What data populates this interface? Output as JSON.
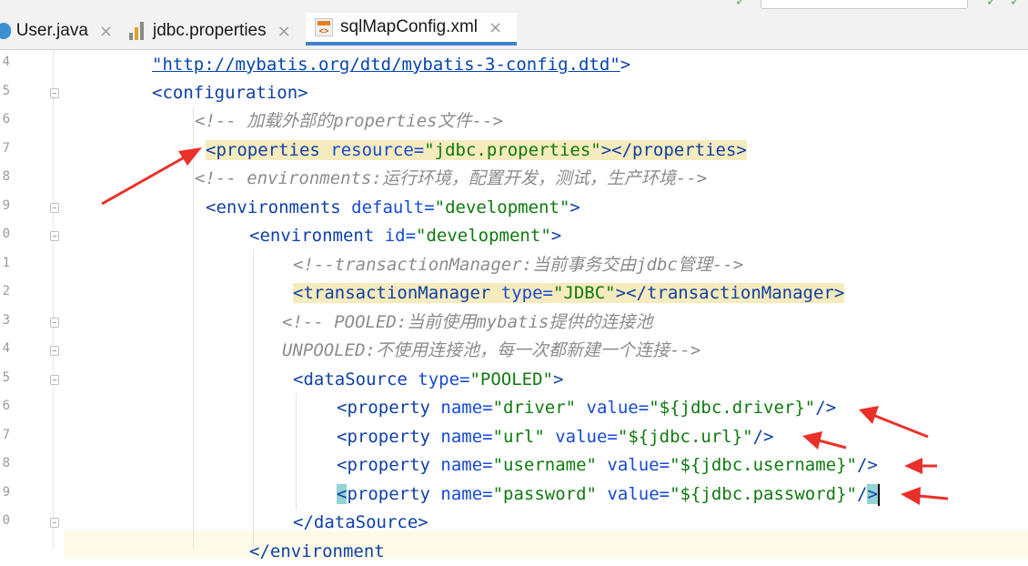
{
  "tabs": [
    {
      "label": "User.java",
      "icon": "java-class-icon"
    },
    {
      "label": "jdbc.properties",
      "icon": "properties-file-icon"
    },
    {
      "label": "sqlMapConfig.xml",
      "icon": "xml-file-icon",
      "active": true
    }
  ],
  "gutter": {
    "line_numbers": [
      "4",
      "5",
      "6",
      "7",
      "8",
      "9",
      "0",
      "1",
      "2",
      "3",
      "4",
      "5",
      "6",
      "7",
      "8",
      "9",
      "0"
    ]
  },
  "code": {
    "l1_url": "\"http://mybatis.org/dtd/mybatis-3-config.dtd\"",
    "l1_end": ">",
    "l2_tag": "<configuration>",
    "l3_comment": "<!-- 加载外部的properties文件-->",
    "l4_open": "<properties",
    "l4_attr": " resource=",
    "l4_val": "\"jdbc.properties\"",
    "l4_close": "></properties>",
    "l5_comment": "<!-- environments:运行环境，配置开发，测试，生产环境-->",
    "l6_open": "<environments",
    "l6_attr": " default=",
    "l6_val": "\"development\"",
    "l6_close": ">",
    "l7_open": "<environment",
    "l7_attr": " id=",
    "l7_val": "\"development\"",
    "l7_close": ">",
    "l8_comment": "<!--transactionManager:当前事务交由jdbc管理-->",
    "l9_open": "<transactionManager",
    "l9_attr": " type=",
    "l9_val": "\"JDBC\"",
    "l9_close": "></transactionManager>",
    "l10_comment": "<!-- POOLED:当前使用mybatis提供的连接池",
    "l11_comment": "UNPOOLED:不使用连接池，每一次都新建一个连接-->",
    "l12_open": "<dataSource",
    "l12_attr": " type=",
    "l12_val": "\"POOLED\"",
    "l12_close": ">",
    "prop_open": "<property",
    "prop_name_attr": " name=",
    "prop_value_attr": " value=",
    "prop_close": "/>",
    "p_lt": "<",
    "p_tag": "property",
    "p_slash": "/",
    "p_gt": ">",
    "l13_name": "\"driver\"",
    "l13_value": "\"${jdbc.driver}\"",
    "l14_name": "\"url\"",
    "l14_value": "\"${jdbc.url}\"",
    "l15_name": "\"username\"",
    "l15_value": "\"${jdbc.username}\"",
    "l16_name": "\"password\"",
    "l16_value": "\"${jdbc.password}\"",
    "l17_tag": "</dataSource>",
    "l18_partial": "</environment"
  },
  "annotation_color": "#e8312a"
}
